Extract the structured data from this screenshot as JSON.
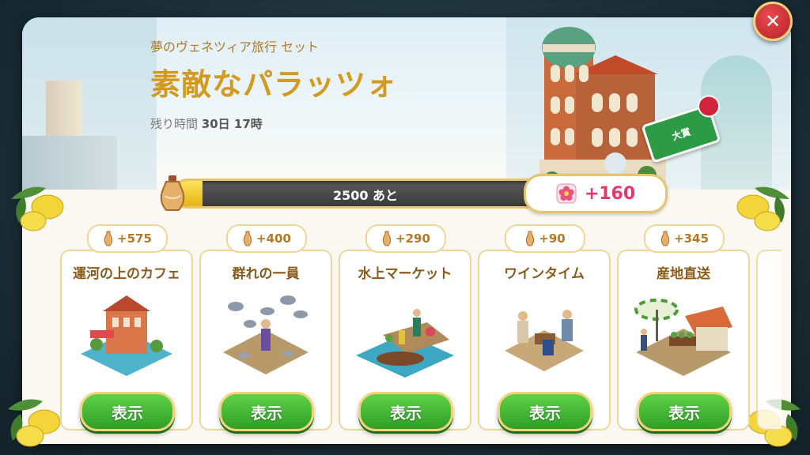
{
  "header": {
    "set_name": "夢のヴェネツィア旅行 セット",
    "title": "素敵なパラッツォ",
    "timer_label": "残り時間",
    "timer_value": "30日 17時",
    "badge_label": "大賞"
  },
  "progress": {
    "text": "2500 あと",
    "fill_fraction": 0.07,
    "reward_value": "+160",
    "reward_icon": "flower-icon"
  },
  "cards": [
    {
      "name": "運河の上のカフェ",
      "points": "+575",
      "button": "表示"
    },
    {
      "name": "群れの一員",
      "points": "+400",
      "button": "表示"
    },
    {
      "name": "水上マーケット",
      "points": "+290",
      "button": "表示"
    },
    {
      "name": "ワインタイム",
      "points": "+90",
      "button": "表示"
    },
    {
      "name": "産地直送",
      "points": "+345",
      "button": "表示"
    }
  ],
  "colors": {
    "title": "#d39a22",
    "button_green": "#3db32f",
    "reward_pink": "#e23a6b",
    "close_red": "#c8232e"
  }
}
